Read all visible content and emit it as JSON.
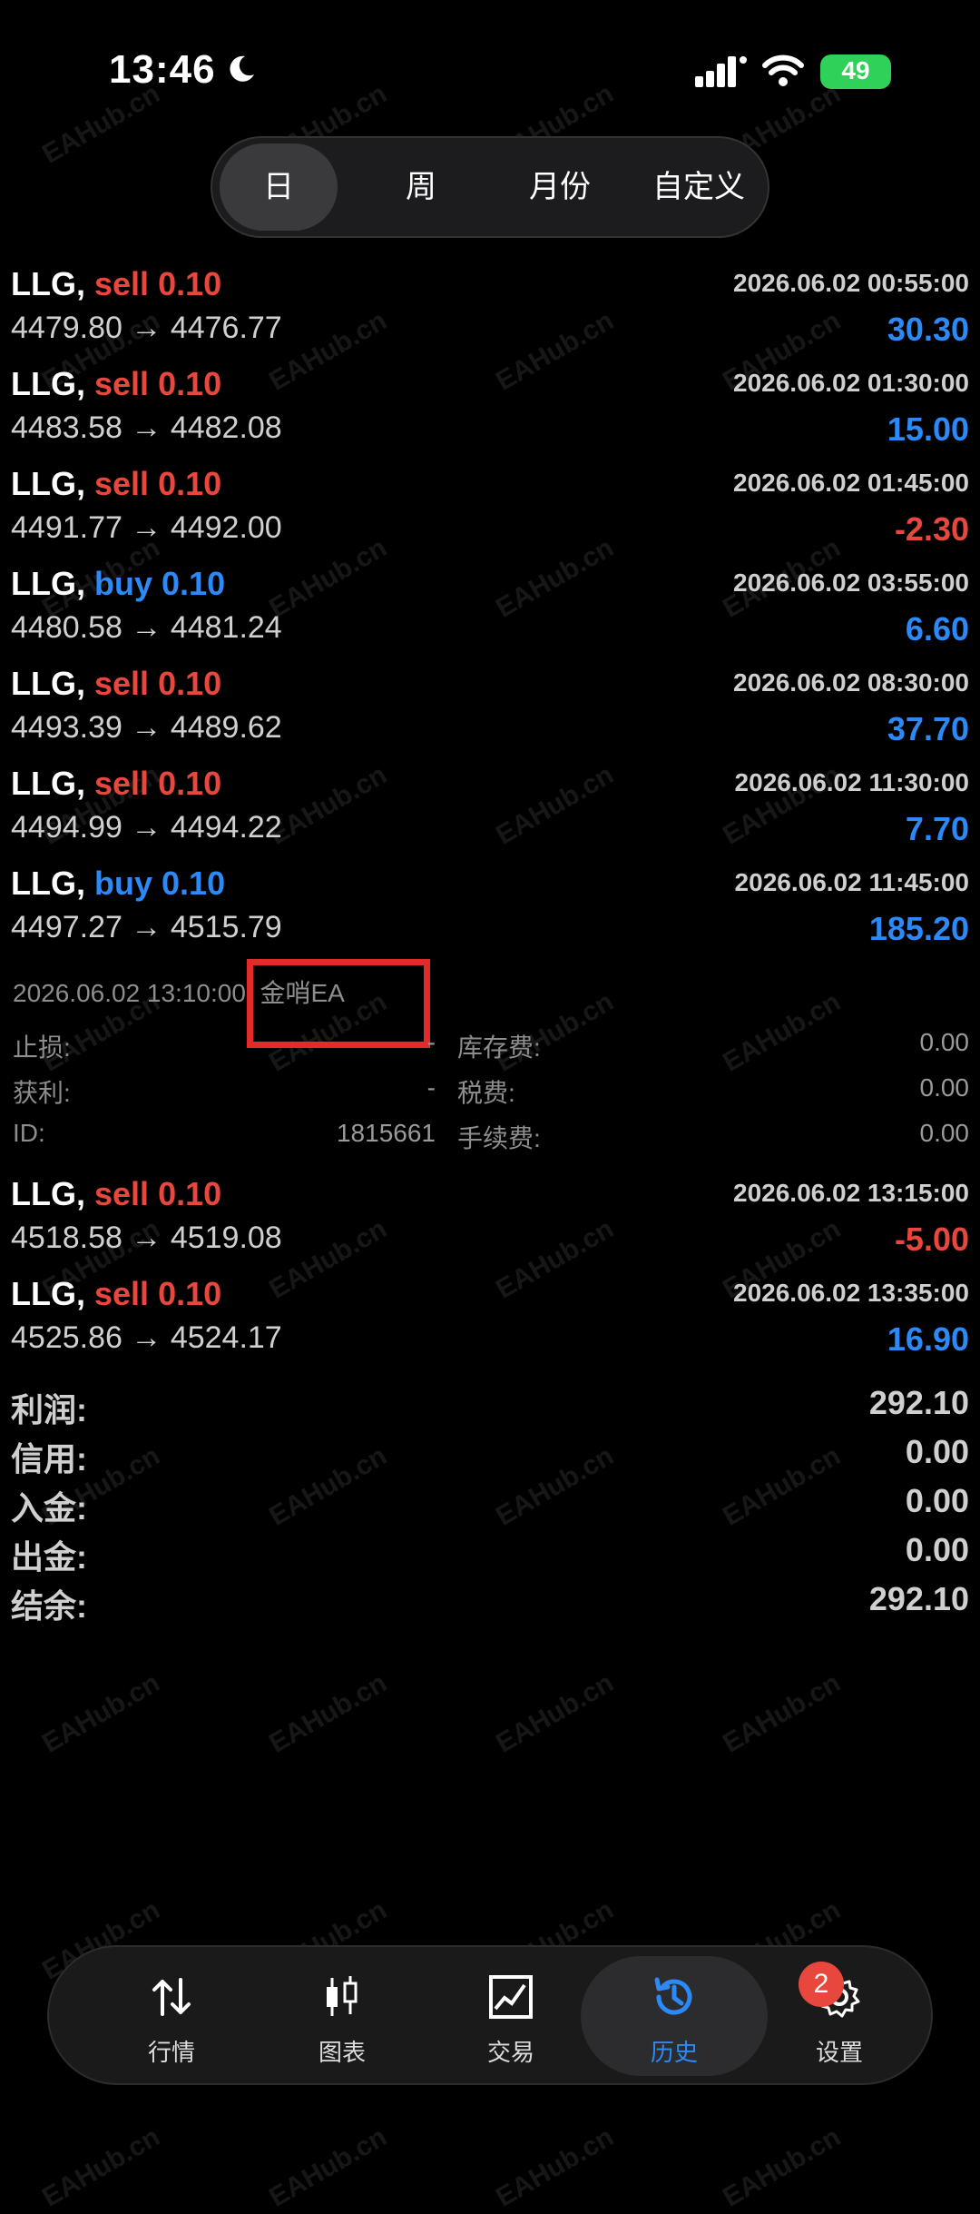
{
  "status_bar": {
    "time": "13:46",
    "battery": "49"
  },
  "period_tabs": [
    "日",
    "周",
    "月份",
    "自定义"
  ],
  "trades": [
    {
      "symbol": "LLG,",
      "side": "sell",
      "volume": "0.10",
      "date": "2026.06.02 00:55:00",
      "open": "4479.80",
      "arrow": "→",
      "close": "4476.77",
      "profit": "30.30"
    },
    {
      "symbol": "LLG,",
      "side": "sell",
      "volume": "0.10",
      "date": "2026.06.02 01:30:00",
      "open": "4483.58",
      "arrow": "→",
      "close": "4482.08",
      "profit": "15.00"
    },
    {
      "symbol": "LLG,",
      "side": "sell",
      "volume": "0.10",
      "date": "2026.06.02 01:45:00",
      "open": "4491.77",
      "arrow": "→",
      "close": "4492.00",
      "profit": "-2.30"
    },
    {
      "symbol": "LLG,",
      "side": "buy",
      "volume": "0.10",
      "date": "2026.06.02 03:55:00",
      "open": "4480.58",
      "arrow": "→",
      "close": "4481.24",
      "profit": "6.60"
    },
    {
      "symbol": "LLG,",
      "side": "sell",
      "volume": "0.10",
      "date": "2026.06.02 08:30:00",
      "open": "4493.39",
      "arrow": "→",
      "close": "4489.62",
      "profit": "37.70"
    },
    {
      "symbol": "LLG,",
      "side": "sell",
      "volume": "0.10",
      "date": "2026.06.02 11:30:00",
      "open": "4494.99",
      "arrow": "→",
      "close": "4494.22",
      "profit": "7.70"
    },
    {
      "symbol": "LLG,",
      "side": "buy",
      "volume": "0.10",
      "date": "2026.06.02 11:45:00",
      "open": "4497.27",
      "arrow": "→",
      "close": "4515.79",
      "profit": "185.20"
    }
  ],
  "trade_detail": {
    "title": "2026.06.02 13:10:00, 金哨EA",
    "stop_loss_label": "止损:",
    "stop_loss_value": "-",
    "take_profit_label": "获利:",
    "take_profit_value": "-",
    "id_label": "ID:",
    "id_value": "1815661",
    "swap_label": "库存费:",
    "swap_value": "0.00",
    "tax_label": "税费:",
    "tax_value": "0.00",
    "fee_label": "手续费:",
    "fee_value": "0.00"
  },
  "trades_after": [
    {
      "symbol": "LLG,",
      "side": "sell",
      "volume": "0.10",
      "date": "2026.06.02 13:15:00",
      "open": "4518.58",
      "arrow": "→",
      "close": "4519.08",
      "profit": "-5.00"
    },
    {
      "symbol": "LLG,",
      "side": "sell",
      "volume": "0.10",
      "date": "2026.06.02 13:35:00",
      "open": "4525.86",
      "arrow": "→",
      "close": "4524.17",
      "profit": "16.90"
    }
  ],
  "summary": [
    {
      "label": "利润:",
      "value": "292.10"
    },
    {
      "label": "信用:",
      "value": "0.00"
    },
    {
      "label": "入金:",
      "value": "0.00"
    },
    {
      "label": "出金:",
      "value": "0.00"
    },
    {
      "label": "结余:",
      "value": "292.10"
    }
  ],
  "watermark": "EAHub.cn",
  "tab_bar": {
    "items": [
      "行情",
      "图表",
      "交易",
      "历史",
      "设置"
    ],
    "active": "历史",
    "settings_badge": "2"
  },
  "colors": {
    "sell": "#e8473e",
    "buy": "#2b8af7",
    "active_tab": "#2b8af7",
    "battery": "#2fd158"
  },
  "icons": [
    "moon-icon",
    "signal-icon",
    "wifi-icon",
    "battery-icon",
    "arrows-updown-icon",
    "candlestick-icon",
    "chart-line-icon",
    "history-clock-icon",
    "gear-icon"
  ]
}
